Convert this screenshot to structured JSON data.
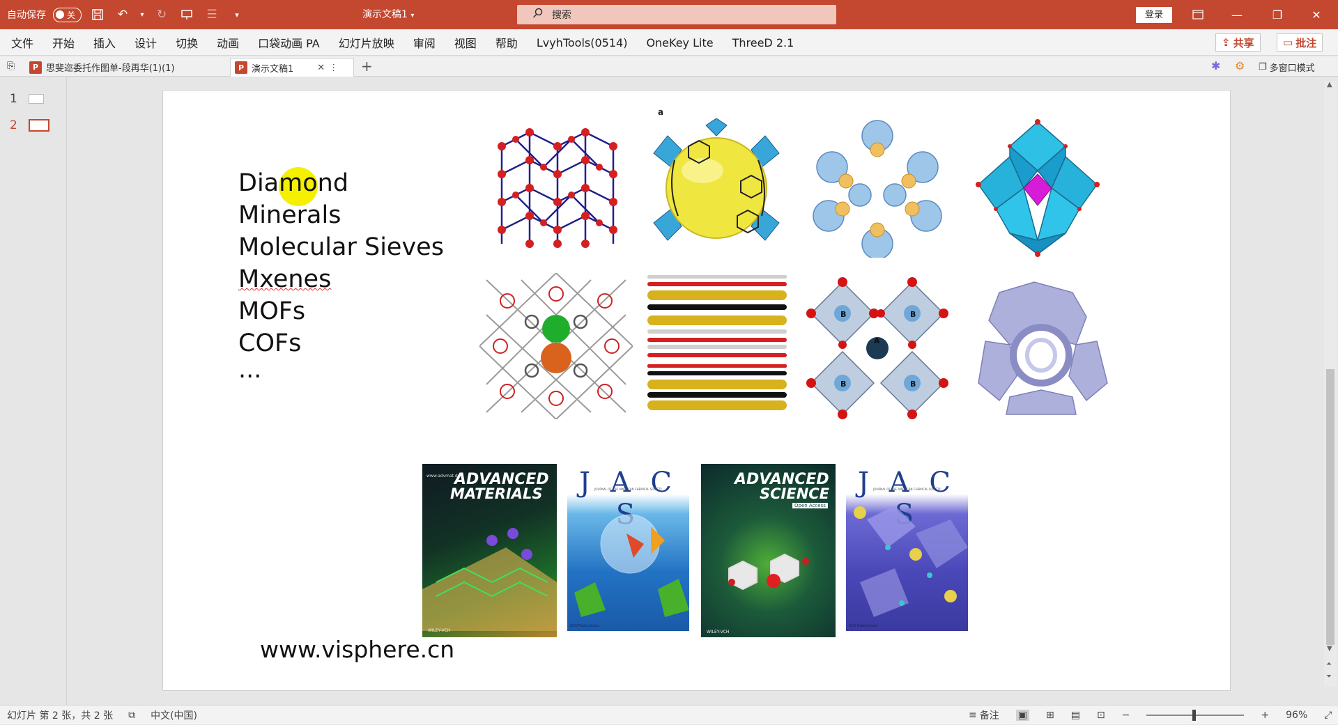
{
  "titlebar": {
    "autosave_label": "自动保存",
    "autosave_state": "关",
    "doc_title": "演示文稿1",
    "search_placeholder": "搜索",
    "login_label": "登录"
  },
  "ribbon": {
    "tabs": [
      "文件",
      "开始",
      "插入",
      "设计",
      "切换",
      "动画",
      "口袋动画 PA",
      "幻灯片放映",
      "审阅",
      "视图",
      "帮助",
      "LvyhTools(0514)",
      "OneKey Lite",
      "ThreeD 2.1"
    ],
    "share_label": "共享",
    "comment_label": "批注"
  },
  "doc_tabs": {
    "tab1_label": "思斐迩委托作图单-段再华(1)(1)",
    "tab2_label": "演示文稿1",
    "multiwindow_label": "多窗口模式"
  },
  "thumbnails": {
    "slide1_num": "1",
    "slide2_num": "2"
  },
  "slide": {
    "items": [
      "Diamond",
      "Minerals",
      "Molecular Sieves",
      "Mxenes",
      "MOFs",
      "COFs",
      "..."
    ],
    "website": "www.visphere.cn",
    "panel_label": "a",
    "covers": {
      "adv_mat_title_1": "ADVANCED",
      "adv_mat_title_2": "MATERIALS",
      "adv_mat_url": "www.advmat.de",
      "adv_mat_publisher": "WILEY-VCH",
      "jacs1_title": "J A C S",
      "jacs1_subtitle": "JOURNAL OF THE AMERICAN CHEMICAL SOCIETY",
      "jacs1_publisher": "ACS Publications",
      "adv_sci_title_1": "ADVANCED",
      "adv_sci_title_2": "SCIENCE",
      "adv_sci_badge": "Open Access",
      "adv_sci_publisher": "WILEY-VCH",
      "jacs2_title": "J A C S",
      "jacs2_subtitle": "JOURNAL OF THE AMERICAN CHEMICAL SOCIETY",
      "jacs2_publisher": "ACS Publications"
    }
  },
  "statusbar": {
    "slide_info": "幻灯片 第 2 张，共 2 张",
    "language": "中文(中国)",
    "notes_label": "备注",
    "zoom_minus": "−",
    "zoom_plus": "+",
    "zoom_level": "96%"
  },
  "colors": {
    "accent": "#c4472f"
  }
}
